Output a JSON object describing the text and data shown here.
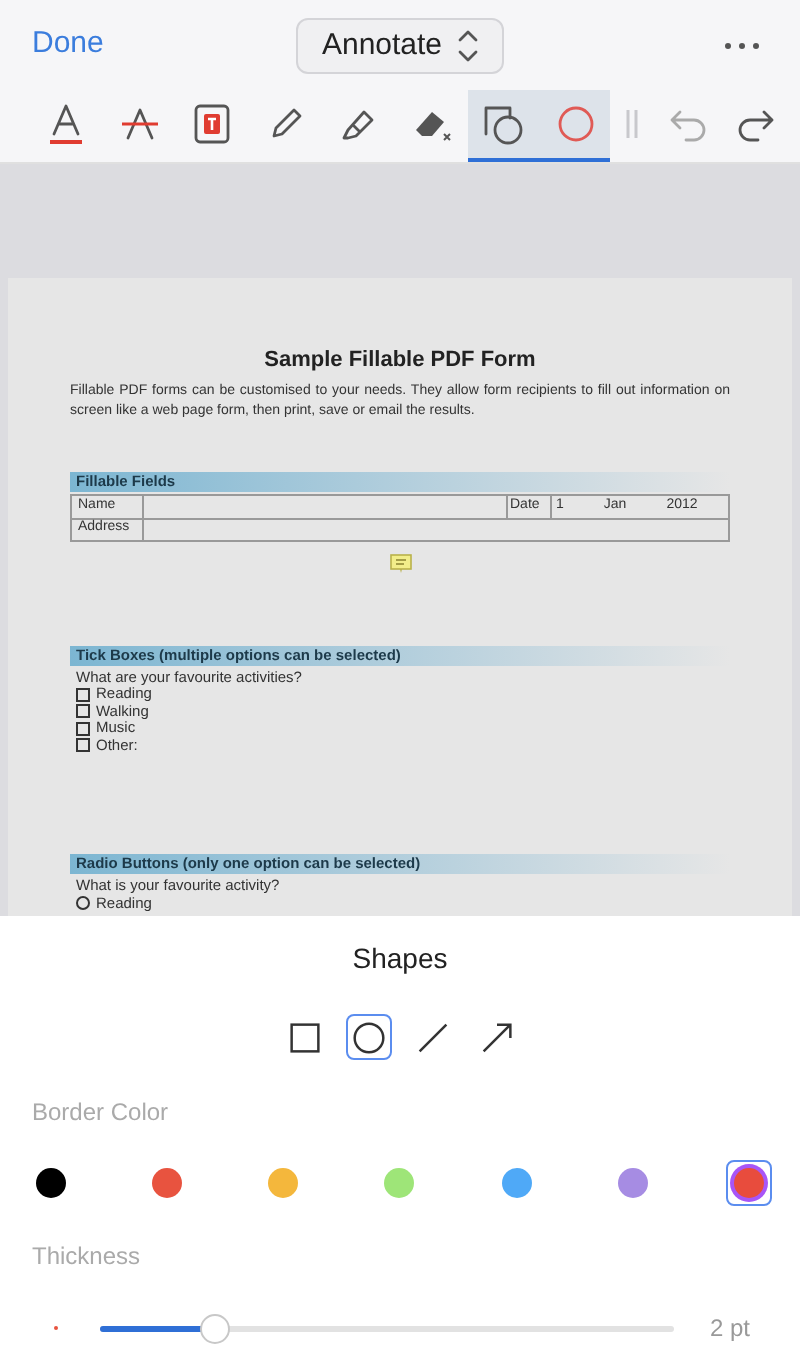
{
  "header": {
    "done": "Done",
    "mode": "Annotate"
  },
  "tools": [
    {
      "kind": "text-color",
      "selected": false
    },
    {
      "kind": "strike",
      "selected": false
    },
    {
      "kind": "text-box",
      "selected": false
    },
    {
      "kind": "pencil",
      "selected": false
    },
    {
      "kind": "highlighter",
      "selected": false
    },
    {
      "kind": "eraser",
      "selected": false
    },
    {
      "kind": "shapes",
      "selected": true
    },
    {
      "kind": "shape-color",
      "selected": true
    },
    {
      "kind": "separator",
      "selected": false
    },
    {
      "kind": "undo",
      "selected": false
    },
    {
      "kind": "redo",
      "selected": false
    }
  ],
  "document": {
    "title": "Sample Fillable PDF Form",
    "intro": "Fillable PDF forms can be customised to your needs. They allow form recipients to fill out information on screen like a web page form, then print, save or email the results.",
    "sections": [
      {
        "kind": "fields",
        "heading": "Fillable Fields",
        "rows": [
          {
            "label": "Name",
            "date_label": "Date",
            "date": [
              "1",
              "Jan",
              "2012"
            ]
          },
          {
            "label": "Address"
          }
        ]
      },
      {
        "kind": "checkboxes",
        "heading": "Tick Boxes (multiple options can be selected)",
        "question": "What are your favourite activities?",
        "options": [
          {
            "label": "Reading",
            "checked": false
          },
          {
            "label": "Walking",
            "checked": false
          },
          {
            "label": "Music",
            "checked": false
          },
          {
            "label": "Other:",
            "checked": false
          }
        ]
      },
      {
        "kind": "radios",
        "heading": "Radio Buttons (only one option can be selected)",
        "question": "What is your favourite activity?",
        "options": [
          {
            "label": "Reading",
            "selected": false
          }
        ]
      }
    ]
  },
  "panel": {
    "title": "Shapes",
    "shapes": [
      {
        "kind": "rectangle",
        "selected": false
      },
      {
        "kind": "circle",
        "selected": true
      },
      {
        "kind": "line",
        "selected": false
      },
      {
        "kind": "arrow",
        "selected": false
      }
    ],
    "border_color_label": "Border Color",
    "colors": [
      {
        "kind": "swatch",
        "color": "#000000",
        "selected": false
      },
      {
        "kind": "swatch",
        "color": "#e8533f",
        "selected": false
      },
      {
        "kind": "swatch",
        "color": "#f4b73c",
        "selected": false
      },
      {
        "kind": "swatch",
        "color": "#9ee578",
        "selected": false
      },
      {
        "kind": "swatch",
        "color": "#4fa9f7",
        "selected": false
      },
      {
        "kind": "swatch",
        "color": "#a68ce3",
        "selected": false
      },
      {
        "kind": "picker",
        "color": "#e84c3d",
        "selected": true
      }
    ],
    "thickness_label": "Thickness",
    "thickness": {
      "level": 0.2,
      "reading": "2 pt"
    }
  }
}
